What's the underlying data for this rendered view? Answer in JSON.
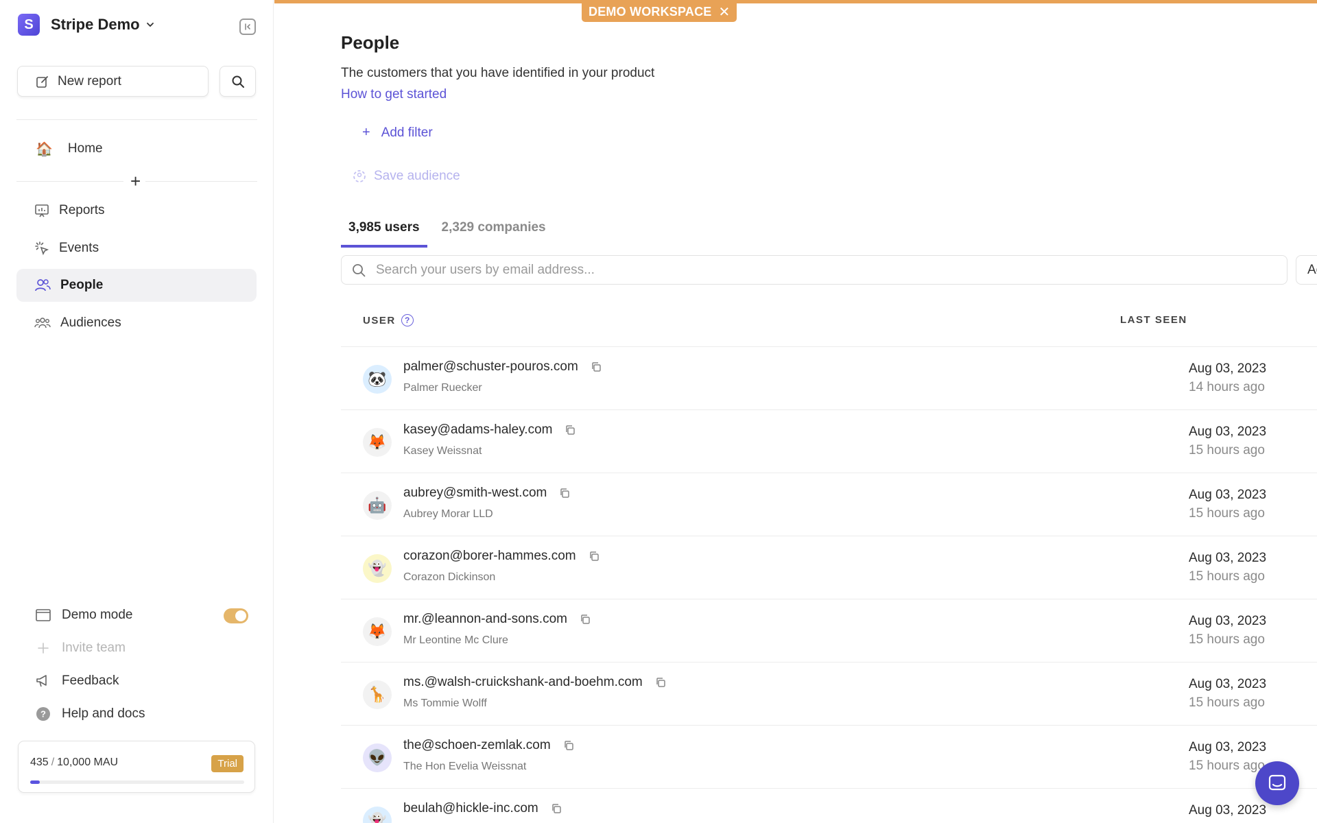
{
  "workspace": {
    "logo_letter": "S",
    "name": "Stripe Demo"
  },
  "sidebar": {
    "new_report_label": "New report",
    "home_emoji": "🏠",
    "home_label": "Home",
    "add_symbol": "+",
    "nav": [
      {
        "label": "Reports",
        "icon": "reports-icon"
      },
      {
        "label": "Events",
        "icon": "events-icon"
      },
      {
        "label": "People",
        "icon": "people-icon",
        "active": true
      },
      {
        "label": "Audiences",
        "icon": "audiences-icon"
      }
    ],
    "bottom": {
      "demo_mode": "Demo mode",
      "invite_team": "Invite team",
      "feedback": "Feedback",
      "help": "Help and docs"
    },
    "mau": {
      "used": "435",
      "total": "10,000 MAU",
      "badge": "Trial",
      "progress_pct": 4.35
    }
  },
  "banner": {
    "label": "DEMO WORKSPACE",
    "close": "✕"
  },
  "page": {
    "title": "People",
    "subtitle": "The customers that you have identified in your product",
    "get_started": "How to get started",
    "add_filter": "Add filter",
    "add_filter_symbol": "+",
    "save_audience": "Save audience",
    "tabs": [
      "3,985 users",
      "2,329 companies"
    ],
    "search_placeholder": "Search your users by email address...",
    "extra_button": "Ac"
  },
  "table": {
    "col_user": "USER",
    "col_help": "?",
    "col_last_seen": "LAST SEEN",
    "rows": [
      {
        "email": "palmer@schuster-pouros.com",
        "name": "Palmer Ruecker",
        "date": "Aug 03, 2023",
        "ago": "14 hours ago",
        "avatar": "🐼",
        "avatar_bg": "#dbeeff"
      },
      {
        "email": "kasey@adams-haley.com",
        "name": "Kasey Weissnat",
        "date": "Aug 03, 2023",
        "ago": "15 hours ago",
        "avatar": "🦊",
        "avatar_bg": "#f2f2f2"
      },
      {
        "email": "aubrey@smith-west.com",
        "name": "Aubrey Morar LLD",
        "date": "Aug 03, 2023",
        "ago": "15 hours ago",
        "avatar": "🤖",
        "avatar_bg": "#f2f2f2"
      },
      {
        "email": "corazon@borer-hammes.com",
        "name": "Corazon Dickinson",
        "date": "Aug 03, 2023",
        "ago": "15 hours ago",
        "avatar": "👻",
        "avatar_bg": "#fbf7c8"
      },
      {
        "email": "mr.@leannon-and-sons.com",
        "name": "Mr Leontine Mc Clure",
        "date": "Aug 03, 2023",
        "ago": "15 hours ago",
        "avatar": "🦊",
        "avatar_bg": "#f2f2f2"
      },
      {
        "email": "ms.@walsh-cruickshank-and-boehm.com",
        "name": "Ms Tommie Wolff",
        "date": "Aug 03, 2023",
        "ago": "15 hours ago",
        "avatar": "🦒",
        "avatar_bg": "#f2f2f2"
      },
      {
        "email": "the@schoen-zemlak.com",
        "name": "The Hon Evelia Weissnat",
        "date": "Aug 03, 2023",
        "ago": "15 hours ago",
        "avatar": "👽",
        "avatar_bg": "#e6e4fb"
      },
      {
        "email": "beulah@hickle-inc.com",
        "name": "",
        "date": "Aug 03, 2023",
        "ago": "",
        "avatar": "👻",
        "avatar_bg": "#dbeeff"
      }
    ]
  },
  "colors": {
    "accent": "#5c53d6",
    "banner": "#e8a256",
    "trial": "#d7a248",
    "chat": "#4d47c9"
  }
}
